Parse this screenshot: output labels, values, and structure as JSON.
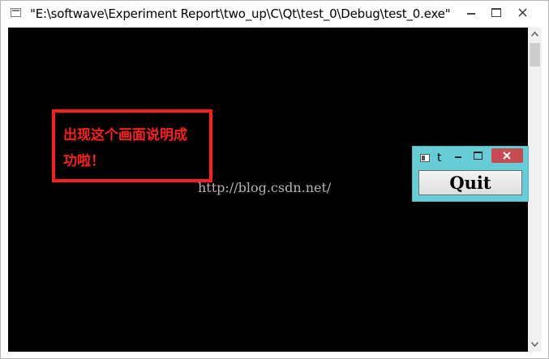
{
  "console_window": {
    "title": "\"E:\\softwave\\Experiment Report\\two_up\\C\\Qt\\test_0\\Debug\\test_0.exe\""
  },
  "annotation": {
    "line1": "出现这个画面说明成",
    "line2": "功啦！"
  },
  "watermark": "http://blog.csdn.net/",
  "qt_window": {
    "title": "t",
    "quit_label": "Quit"
  },
  "colors": {
    "console_bg": "#000000",
    "annotation": "#ff1e1e",
    "qt_window_bg": "#66cdd6",
    "close_button": "#c74b50"
  }
}
